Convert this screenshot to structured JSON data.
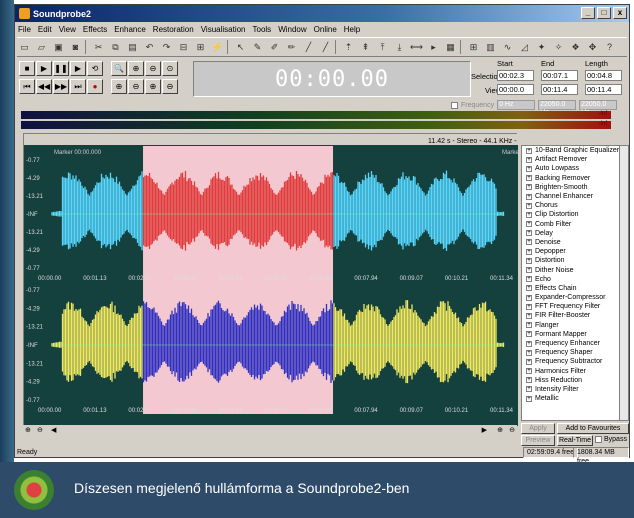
{
  "window": {
    "title": "Soundprobe2",
    "controls": [
      "_",
      "□",
      "x"
    ]
  },
  "menu": [
    "File",
    "Edit",
    "View",
    "Effects",
    "Enhance",
    "Restoration",
    "Visualisation",
    "Tools",
    "Window",
    "Online",
    "Help"
  ],
  "clock": "00:00.00",
  "times": {
    "headers": [
      "Start",
      "End",
      "Length"
    ],
    "selection_label": "Selection",
    "view_label": "View",
    "selection": [
      "00:02.3",
      "00:07.1",
      "00:04.8"
    ],
    "view": [
      "00:00.0",
      "00:11.4",
      "00:11.4"
    ],
    "frequency_label": "Frequency",
    "frequency": [
      "0 Hz",
      "22050.0 Hz",
      "22050.0 Hz"
    ]
  },
  "meter_labels": [
    "-Inf",
    "-Inf"
  ],
  "wave": {
    "info": "11.42 s - Stereo - 44.1 KHz - 16 Bits",
    "marker": "Marker 00:00.000",
    "marker_r": "Marke",
    "db_labels_top": [
      "-0.77",
      "-4.29",
      "-13.21",
      "-INF",
      "-13.21",
      "-4.29",
      "-0.77"
    ],
    "db_labels_bottom": [
      "-0.77",
      "-4.29",
      "-13.21",
      "-INF",
      "-13.21",
      "-4.29",
      "-0.77"
    ],
    "time_labels_top": [
      "00:00.00",
      "00:01.13",
      "00:02.27",
      "00:03.40",
      "00:04.54",
      "00:05.67",
      "00:06.81",
      "00:07.94",
      "00:09.07",
      "00:10.21",
      "00:11.34"
    ],
    "time_labels_bottom": [
      "00:00.00",
      "00:01.13",
      "00:02.27",
      "00:03.40",
      "00:04.54",
      "00:05.67",
      "00:06.80",
      "00:07.94",
      "00:09.07",
      "00:10.21",
      "00:11.34"
    ],
    "colors": {
      "bg": "#14403e",
      "selection": "#f4c8d0",
      "ch1": "#58d8ff",
      "ch1_sel": "#e03a3a",
      "ch2": "#f0e860",
      "ch2_sel": "#3030c0"
    }
  },
  "effects": [
    "10-Band Graphic Equalizer",
    "Artifact Remover",
    "Auto Lowpass",
    "Backing Remover",
    "Brighten-Smooth",
    "Channel Enhancer",
    "Chorus",
    "Clip Distortion",
    "Comb Filter",
    "Delay",
    "Denoise",
    "Depopper",
    "Distortion",
    "Dither Noise",
    "Echo",
    "Effects Chain",
    "Expander-Compressor",
    "FFT Frequency Filter",
    "FIR Filter-Booster",
    "Flanger",
    "Formant Mapper",
    "Frequency Enhancer",
    "Frequency Shaper",
    "Frequency Subtractor",
    "Harmonics Filter",
    "Hiss Reduction",
    "Intensity Filter",
    "Metallic"
  ],
  "effect_buttons": {
    "apply": "Apply",
    "favourites": "Add to Favourites",
    "preview": "Preview",
    "realtime": "Real-Time",
    "bypass": "Bypass"
  },
  "status": {
    "ready": "Ready",
    "time_free": "02:59:09.4 free",
    "mb_free": "1808.34 MB free"
  },
  "caption": "Díszesen megjelenő hullámforma a Soundprobe2-ben"
}
